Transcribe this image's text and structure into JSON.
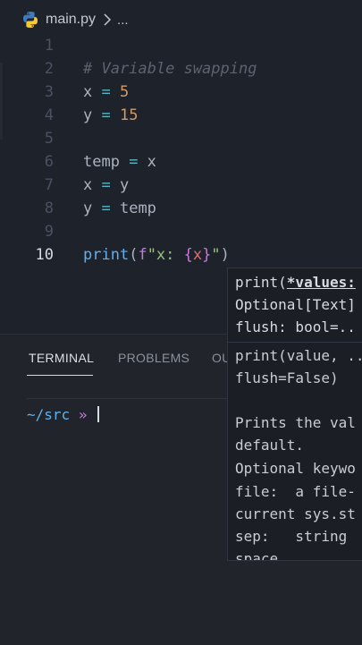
{
  "breadcrumb": {
    "file": "main.py",
    "ellipsis": "..."
  },
  "editor": {
    "active_line": 10,
    "lines": [
      {
        "n": "1",
        "code": ""
      },
      {
        "n": "2",
        "comment": "# Variable swapping"
      },
      {
        "n": "3",
        "a": "x",
        "op": " = ",
        "b": "5"
      },
      {
        "n": "4",
        "a": "y",
        "op": " = ",
        "b": "15"
      },
      {
        "n": "5",
        "code": ""
      },
      {
        "n": "6",
        "a": "temp",
        "op": " = ",
        "b": "x"
      },
      {
        "n": "7",
        "a": "x",
        "op": " = ",
        "b": "y"
      },
      {
        "n": "8",
        "a": "y",
        "op": " = ",
        "b": "temp"
      },
      {
        "n": "9",
        "code": ""
      },
      {
        "n": "10",
        "fn": "print",
        "p1": "(",
        "pre": "f",
        "str1": "\"x: ",
        "b1": "{",
        "v": "x",
        "b2": "}",
        "str2": "\"",
        "p2": ")"
      }
    ]
  },
  "hover": {
    "sig1_a": "print(",
    "sig1_b": "*values:",
    "sig2": "Optional[Text]",
    "sig3": "flush: bool=..",
    "doc": [
      "print(value, ..",
      "flush=False)",
      "",
      "Prints the val",
      "default.    ",
      "Optional keywo",
      "file:  a file-",
      "current sys.st",
      "sep:   string ",
      "space."
    ]
  },
  "panel": {
    "tabs": [
      "TERMINAL",
      "PROBLEMS",
      "OU"
    ],
    "active_tab": "TERMINAL",
    "prompt_path": "~/src",
    "prompt_arrow": "»"
  },
  "colors": {
    "background": "#1e222a",
    "panel": "#21252b",
    "keyword_blue": "#61afef",
    "string_green": "#98c379",
    "number_orange": "#d19a66"
  }
}
